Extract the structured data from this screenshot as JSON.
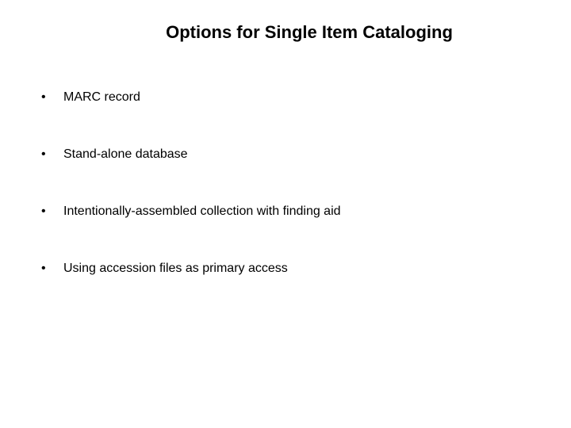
{
  "slide": {
    "title": "Options for Single Item Cataloging",
    "bullets": [
      {
        "text": "MARC record"
      },
      {
        "text": "Stand-alone database"
      },
      {
        "text": "Intentionally-assembled collection with finding aid"
      },
      {
        "text": "Using accession files as primary access"
      }
    ],
    "bullet_marker": "•"
  }
}
